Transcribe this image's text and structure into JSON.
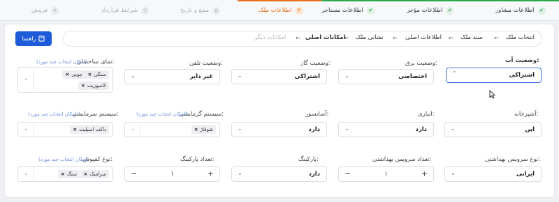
{
  "steps": [
    {
      "label": "اطلاعات مشاور",
      "state": "done"
    },
    {
      "label": "اطلاعات مؤجر",
      "state": "done"
    },
    {
      "label": "اطلاعات مستاجر",
      "state": "done"
    },
    {
      "label": "اطلاعات ملک",
      "state": "active",
      "num": "۴"
    },
    {
      "label": "مبلغ و تاریخ",
      "state": "todo",
      "num": "۵"
    },
    {
      "label": "شرایط قرارداد",
      "state": "todo",
      "num": "۶"
    },
    {
      "label": "فروش",
      "state": "todo",
      "num": "۷"
    }
  ],
  "help_button": "راهنما",
  "breadcrumb": [
    "انتخاب ملک",
    "سند ملک",
    "اطلاعات اصلی",
    "نشانی ملک",
    "امکانات اصلی"
  ],
  "breadcrumb_dim": "امکانات دیگر",
  "multi_hint": "(امکان انتخاب چند مورد)",
  "fields": {
    "water": {
      "label": "وضعیت آب:",
      "value": "اشتراکی"
    },
    "electricity": {
      "label": "وضعیت برق:",
      "value": "اختصاصی"
    },
    "gas": {
      "label": "وضعیت گاز:",
      "value": "اشتراکی"
    },
    "phone": {
      "label": "وضعیت تلفن:",
      "value": "غیر دایر"
    },
    "facade": {
      "label": "نمای ساختمان:",
      "tags": [
        "سنگی",
        "چوبی",
        "کامپوزیت"
      ]
    },
    "kitchen": {
      "label": "آشپزخانه:",
      "value": "اپن"
    },
    "storage": {
      "label": "انباری:",
      "value": "دارد"
    },
    "elevator": {
      "label": "آسانسور:",
      "value": "دارد"
    },
    "heating": {
      "label": "سیستم گرمایشی:",
      "tags": [
        "شوفاژ"
      ]
    },
    "cooling": {
      "label": "سیستم سرمایشی:",
      "tags": [
        "داکت اسپلیت"
      ]
    },
    "toilet_type": {
      "label": "نوع سرویس بهداشتی:",
      "value": "ایرانی"
    },
    "toilet_count": {
      "label": "تعداد سرویس بهداشتی:",
      "value": "۱"
    },
    "parking": {
      "label": "پارکینگ:",
      "value": "دارد"
    },
    "parking_count": {
      "label": "تعداد پارکینگ:",
      "value": "۱"
    },
    "flooring": {
      "label": "نوع کفپوش:",
      "tags": [
        "سرامیک",
        "سنگ"
      ]
    }
  },
  "colors": {
    "accent": "#1e5bd8",
    "done": "#27a546",
    "active": "#e86f1a",
    "focus": "#3c6fe0"
  },
  "icons": {
    "done": "check-icon",
    "help": "help-icon",
    "select": "chevron-down-icon",
    "remove": "close-icon",
    "increase": "plus-icon",
    "decrease": "minus-icon"
  }
}
